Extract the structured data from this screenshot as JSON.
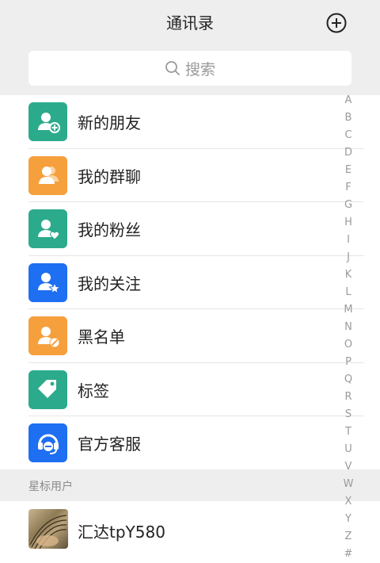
{
  "header": {
    "title": "通讯录"
  },
  "search": {
    "placeholder": "搜索"
  },
  "menu": {
    "items": [
      {
        "label": "新的朋友",
        "icon": "user-add-icon",
        "color": "#2bab8c"
      },
      {
        "label": "我的群聊",
        "icon": "user-group-icon",
        "color": "#f5a03d"
      },
      {
        "label": "我的粉丝",
        "icon": "user-heart-icon",
        "color": "#2bab8c"
      },
      {
        "label": "我的关注",
        "icon": "user-star-icon",
        "color": "#1e6ff1"
      },
      {
        "label": "黑名单",
        "icon": "user-block-icon",
        "color": "#f5a03d"
      },
      {
        "label": "标签",
        "icon": "tag-icon",
        "color": "#2bab8c"
      },
      {
        "label": "官方客服",
        "icon": "headset-icon",
        "color": "#1e6ff1"
      }
    ]
  },
  "starred": {
    "header": "星标用户",
    "contacts": [
      {
        "name": "汇达tpY580"
      }
    ]
  },
  "index_letters": [
    "A",
    "B",
    "C",
    "D",
    "E",
    "F",
    "G",
    "H",
    "I",
    "J",
    "K",
    "L",
    "M",
    "N",
    "O",
    "P",
    "Q",
    "R",
    "S",
    "T",
    "U",
    "V",
    "W",
    "X",
    "Y",
    "Z",
    "#"
  ]
}
